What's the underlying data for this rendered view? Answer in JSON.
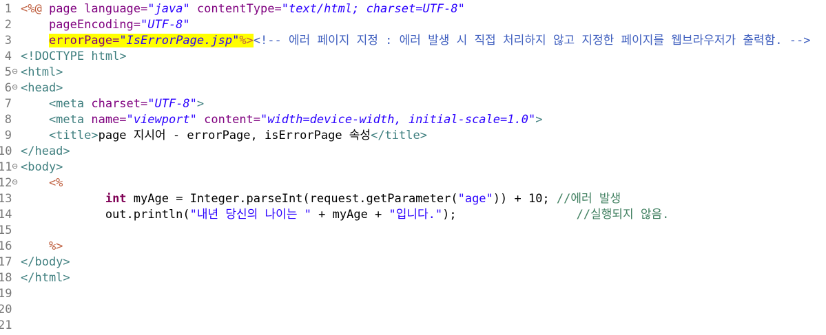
{
  "editor": {
    "lines": [
      {
        "num": "1",
        "fold": "",
        "tokens": [
          {
            "t": "<%@ ",
            "c": "dir"
          },
          {
            "t": "page ",
            "c": "attr"
          },
          {
            "t": "language=",
            "c": "attr"
          },
          {
            "t": "\"java\"",
            "c": "val"
          },
          {
            "t": " contentType=",
            "c": "attr"
          },
          {
            "t": "\"text/html; charset=UTF-8\"",
            "c": "val"
          }
        ]
      },
      {
        "num": "2",
        "fold": "",
        "tokens": [
          {
            "t": "    pageEncoding=",
            "c": "attr"
          },
          {
            "t": "\"UTF-8\"",
            "c": "val"
          }
        ]
      },
      {
        "num": "3",
        "fold": "",
        "tokens": [
          {
            "t": "    ",
            "c": "plain"
          },
          {
            "t": "errorPage=",
            "c": "attr",
            "hl": true
          },
          {
            "t": "\"IsErrorPage.jsp\"",
            "c": "val",
            "hl": true
          },
          {
            "t": "%>",
            "c": "dir",
            "hl": true
          },
          {
            "t": "<!-- 에러 페이지 지정 : 에러 발생 시 직접 처리하지 않고 지정한 페이지를 웹브라우저가 출력함. -->",
            "c": "cmt"
          }
        ]
      },
      {
        "num": "4",
        "fold": "",
        "tokens": [
          {
            "t": "<!DOCTYPE ",
            "c": "tag"
          },
          {
            "t": "html",
            "c": "tag"
          },
          {
            "t": ">",
            "c": "tag"
          }
        ]
      },
      {
        "num": "5",
        "fold": "⊖",
        "tokens": [
          {
            "t": "<html>",
            "c": "tag"
          }
        ]
      },
      {
        "num": "6",
        "fold": "⊖",
        "tokens": [
          {
            "t": "<head>",
            "c": "tag"
          }
        ]
      },
      {
        "num": "7",
        "fold": "",
        "tokens": [
          {
            "t": "    <meta ",
            "c": "tag"
          },
          {
            "t": "charset=",
            "c": "attr"
          },
          {
            "t": "\"UTF-8\"",
            "c": "val"
          },
          {
            "t": ">",
            "c": "tag"
          }
        ]
      },
      {
        "num": "8",
        "fold": "",
        "tokens": [
          {
            "t": "    <meta ",
            "c": "tag"
          },
          {
            "t": "name=",
            "c": "attr"
          },
          {
            "t": "\"viewport\"",
            "c": "val"
          },
          {
            "t": " content=",
            "c": "attr"
          },
          {
            "t": "\"width=device-width, initial-scale=1.0\"",
            "c": "val"
          },
          {
            "t": ">",
            "c": "tag"
          }
        ]
      },
      {
        "num": "9",
        "fold": "",
        "tokens": [
          {
            "t": "    <title>",
            "c": "tag"
          },
          {
            "t": "page 지시어 - errorPage, isErrorPage 속성",
            "c": "plain"
          },
          {
            "t": "</title>",
            "c": "tag"
          }
        ]
      },
      {
        "num": "10",
        "fold": "",
        "tokens": [
          {
            "t": "</head>",
            "c": "tag"
          }
        ]
      },
      {
        "num": "11",
        "fold": "⊖",
        "tokens": [
          {
            "t": "<body>",
            "c": "tag"
          }
        ]
      },
      {
        "num": "12",
        "fold": "⊖",
        "tokens": [
          {
            "t": "    <%",
            "c": "dir"
          }
        ]
      },
      {
        "num": "13",
        "fold": "",
        "tokens": [
          {
            "t": "            ",
            "c": "plain"
          },
          {
            "t": "int",
            "c": "kw"
          },
          {
            "t": " myAge = Integer.parseInt(request.getParameter(",
            "c": "plain"
          },
          {
            "t": "\"age\"",
            "c": "str"
          },
          {
            "t": ")) + 10; ",
            "c": "plain"
          },
          {
            "t": "//에러 발생",
            "c": "jcmt"
          }
        ]
      },
      {
        "num": "14",
        "fold": "",
        "tokens": [
          {
            "t": "            out.println(",
            "c": "plain"
          },
          {
            "t": "\"내년 당신의 나이는 \"",
            "c": "str"
          },
          {
            "t": " + myAge + ",
            "c": "plain"
          },
          {
            "t": "\"입니다.\"",
            "c": "str"
          },
          {
            "t": ");                 ",
            "c": "plain"
          },
          {
            "t": "//실행되지 않음.",
            "c": "jcmt"
          }
        ]
      },
      {
        "num": "15",
        "fold": "",
        "tokens": []
      },
      {
        "num": "16",
        "fold": "",
        "tokens": [
          {
            "t": "    %>",
            "c": "dir"
          }
        ]
      },
      {
        "num": "17",
        "fold": "",
        "tokens": [
          {
            "t": "</body>",
            "c": "tag"
          }
        ]
      },
      {
        "num": "18",
        "fold": "",
        "tokens": [
          {
            "t": "</html>",
            "c": "tag"
          }
        ]
      },
      {
        "num": "19",
        "fold": "",
        "tokens": []
      },
      {
        "num": "20",
        "fold": "",
        "tokens": []
      },
      {
        "num": "21",
        "fold": "",
        "tokens": []
      }
    ]
  },
  "colors": {
    "background": "#ffffff",
    "highlight": "#ffff00",
    "line_number": "#787878",
    "directive": "#bf5f3f",
    "attribute": "#7f007f",
    "value": "#2a00ff",
    "comment": "#3f5fbf",
    "tag": "#3f7f7f",
    "keyword": "#7f0055",
    "java_comment": "#3f7f5f"
  }
}
